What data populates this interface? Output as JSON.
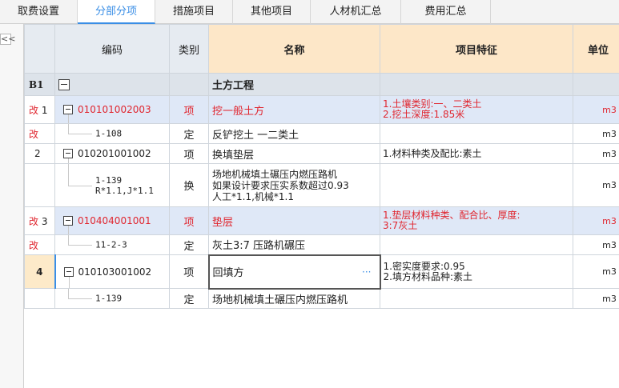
{
  "tabs": [
    {
      "label": "取费设置"
    },
    {
      "label": "分部分项",
      "active": true
    },
    {
      "label": "措施项目"
    },
    {
      "label": "其他项目"
    },
    {
      "label": "人材机汇总"
    },
    {
      "label": "费用汇总"
    }
  ],
  "left_panel": {
    "collapse_label": "<<"
  },
  "columns": {
    "code": "编码",
    "type": "类别",
    "name": "名称",
    "features": "项目特征",
    "unit": "单位"
  },
  "rows": [
    {
      "idx": "B1",
      "code": "",
      "type": "",
      "name": "土方工程",
      "features": [],
      "unit": ""
    },
    {
      "idx_mark": "改",
      "idx": "1",
      "code": "010101002003",
      "type": "项",
      "name": "挖一般土方",
      "features": [
        "1.土壤类别:一、二类土",
        "2.挖土深度:1.85米"
      ],
      "unit": "m3"
    },
    {
      "idx_mark": "改",
      "idx": "",
      "code": "1-108",
      "type": "定",
      "name": "反铲挖土 一二类土",
      "features": [],
      "unit": "m3"
    },
    {
      "idx": "2",
      "code": "010201001002",
      "type": "项",
      "name": "换填垫层",
      "features": [
        "1.材料种类及配比:素土"
      ],
      "unit": "m3"
    },
    {
      "idx": "",
      "code_lines": [
        "1-139",
        "R*1.1,J*1.1"
      ],
      "type": "换",
      "name_lines": [
        "场地机械填土碾压内燃压路机",
        "如果设计要求压实系数超过0.93",
        "人工*1.1,机械*1.1"
      ],
      "features": [],
      "unit": "m3"
    },
    {
      "idx_mark": "改",
      "idx": "3",
      "code": "010404001001",
      "type": "项",
      "name": "垫层",
      "features": [
        "1.垫层材料种类、配合比、厚度:",
        "3:7灰土"
      ],
      "unit": "m3"
    },
    {
      "idx_mark": "改",
      "idx": "",
      "code": "11-2-3",
      "type": "定",
      "name": "灰土3:7 压路机碾压",
      "features": [],
      "unit": "m3"
    },
    {
      "idx": "4",
      "code": "010103001002",
      "type": "项",
      "name": "回填方",
      "name_action": "···",
      "features": [
        "1.密实度要求:0.95",
        "2.填方材料品种:素土"
      ],
      "unit": "m3"
    },
    {
      "idx": "",
      "code": "1-139",
      "type": "定",
      "name": "场地机械填土碾压内燃压路机",
      "features": [],
      "unit": "m3"
    }
  ]
}
